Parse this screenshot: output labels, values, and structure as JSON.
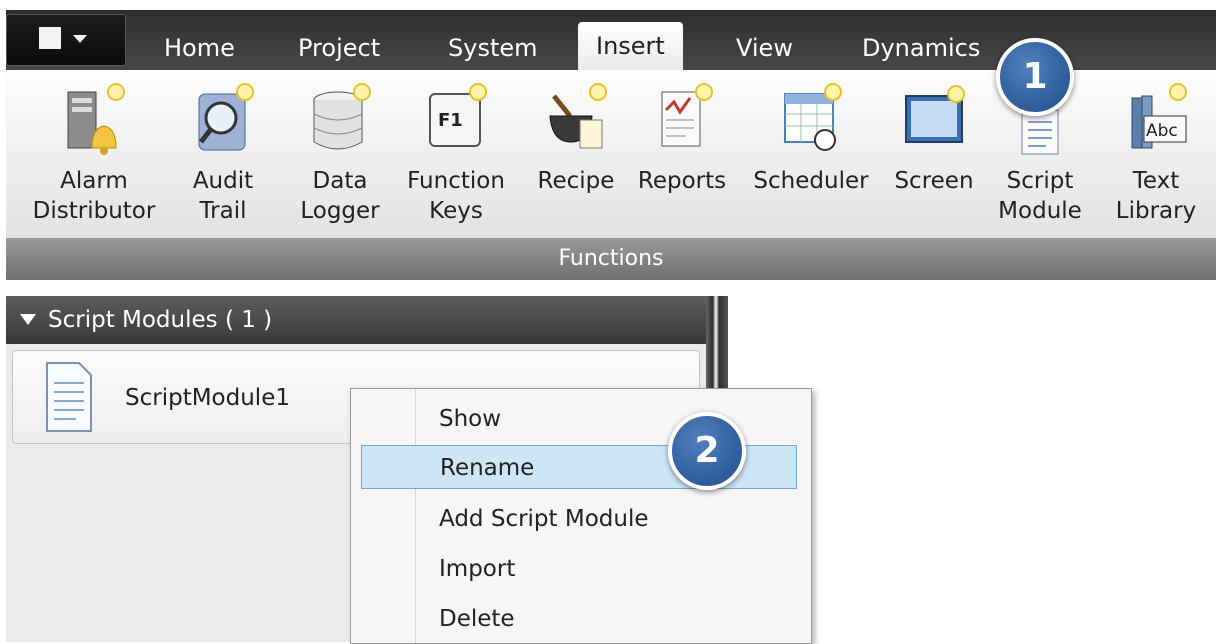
{
  "ribbon": {
    "tabs": [
      {
        "label": "Home"
      },
      {
        "label": "Project"
      },
      {
        "label": "System"
      },
      {
        "label": "Insert",
        "active": true
      },
      {
        "label": "View"
      },
      {
        "label": "Dynamics"
      }
    ],
    "buttons": [
      {
        "label": "Alarm\nDistributor",
        "icon": "alarm-distributor-icon"
      },
      {
        "label": "Audit\nTrail",
        "icon": "audit-trail-icon"
      },
      {
        "label": "Data\nLogger",
        "icon": "data-logger-icon"
      },
      {
        "label": "Function\nKeys",
        "icon": "function-keys-icon",
        "icon_text": "F1"
      },
      {
        "label": "Recipe",
        "icon": "recipe-icon"
      },
      {
        "label": "Reports",
        "icon": "reports-icon"
      },
      {
        "label": "Scheduler",
        "icon": "scheduler-icon"
      },
      {
        "label": "Screen",
        "icon": "screen-icon"
      },
      {
        "label": "Script\nModule",
        "icon": "script-module-icon"
      },
      {
        "label": "Text\nLibrary",
        "icon": "text-library-icon",
        "icon_text": "Abc"
      }
    ],
    "group_label": "Functions"
  },
  "badges": {
    "step1": "1",
    "step2": "2"
  },
  "panel": {
    "title": "Script Modules ( 1 )",
    "items": [
      {
        "label": "ScriptModule1",
        "icon": "document-icon"
      }
    ]
  },
  "context_menu": {
    "items": [
      {
        "label": "Show"
      },
      {
        "label": "Rename",
        "highlighted": true
      },
      {
        "label": "Add Script Module"
      },
      {
        "label": "Import"
      },
      {
        "label": "Delete"
      }
    ]
  },
  "colors": {
    "badge_blue": "#2c5f9e",
    "menu_highlight": "#cde6f7",
    "ribbon_dark": "#3a3a3a"
  }
}
